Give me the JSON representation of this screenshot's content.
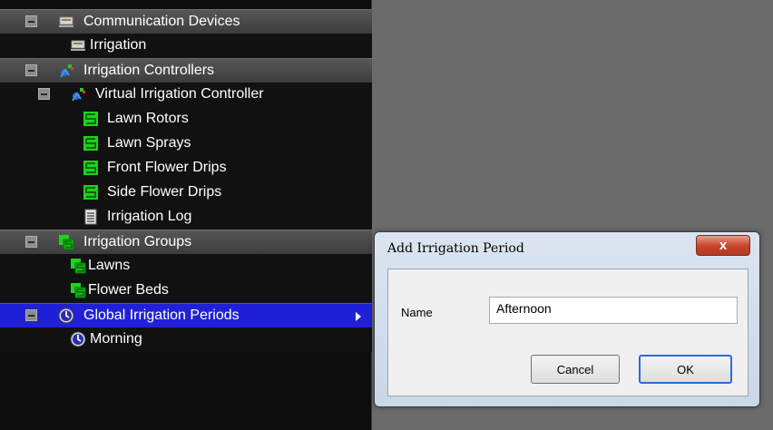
{
  "tree": {
    "items": [
      {
        "label": "Communication Devices",
        "icon": "communication-devices-icon"
      },
      {
        "label": "Irrigation",
        "icon": "communication-device-icon"
      },
      {
        "label": "Irrigation Controllers",
        "icon": "irrigation-controllers-icon"
      },
      {
        "label": "Virtual Irrigation Controller",
        "icon": "irrigation-controller-icon"
      },
      {
        "label": "Lawn Rotors",
        "icon": "zone-icon"
      },
      {
        "label": "Lawn Sprays",
        "icon": "zone-icon"
      },
      {
        "label": "Front Flower Drips",
        "icon": "zone-icon"
      },
      {
        "label": "Side Flower Drips",
        "icon": "zone-icon"
      },
      {
        "label": "Irrigation Log",
        "icon": "log-icon"
      },
      {
        "label": "Irrigation Groups",
        "icon": "irrigation-groups-icon"
      },
      {
        "label": "Lawns",
        "icon": "group-icon"
      },
      {
        "label": "Flower Beds",
        "icon": "group-icon"
      },
      {
        "label": "Global Irrigation Periods",
        "icon": "clock-icon",
        "selected": true
      },
      {
        "label": "Morning",
        "icon": "clock-icon"
      }
    ]
  },
  "dialog": {
    "title": "Add Irrigation Period",
    "close_label": "x",
    "name_label": "Name",
    "name_value": "Afternoon",
    "cancel_label": "Cancel",
    "ok_label": "OK"
  },
  "colors": {
    "selection": "#2020d8",
    "zone_green": "#1ed21e",
    "tree_background": "#0d0d0d"
  }
}
